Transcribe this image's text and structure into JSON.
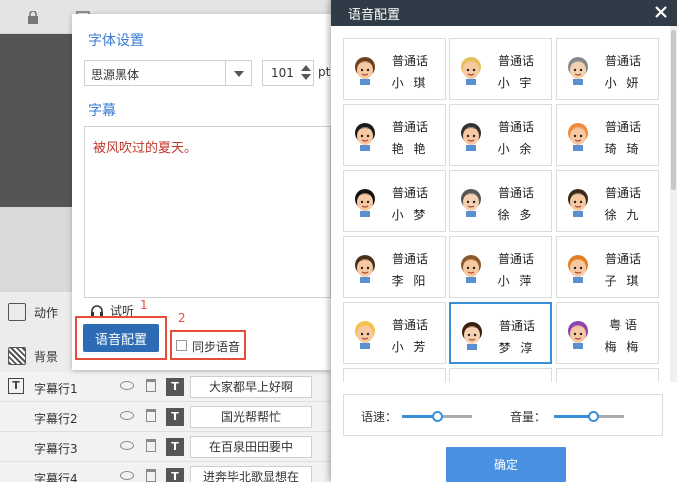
{
  "font_panel": {
    "title": "字体设置",
    "font_name": "思源黑体",
    "font_size": "101",
    "size_unit": "pt",
    "subtitle_title": "字幕",
    "subtitle_text": "被风吹过的夏天。",
    "listen_label": "试听",
    "voice_config_label": "语音配置",
    "sync_label": "同步语音",
    "badge_1": "1",
    "badge_2": "2"
  },
  "left_tools": [
    {
      "label": "动作",
      "icon": "action-icon"
    },
    {
      "label": "背景",
      "icon": "background-icon"
    }
  ],
  "layers": [
    {
      "name": "字幕行1",
      "text": "大家都早上好啊"
    },
    {
      "name": "字幕行2",
      "text": "国光帮帮忙"
    },
    {
      "name": "字幕行3",
      "text": "在百泉田田要中"
    },
    {
      "name": "字幕行4",
      "text": "进奔毕北歌显想在"
    }
  ],
  "voice_dialog": {
    "title": "语音配置",
    "close_icon": "close-icon",
    "voices": [
      {
        "type": "普通话",
        "name": "小 琪",
        "hair": "#6b3e1f",
        "skin": "#f6c9a3"
      },
      {
        "type": "普通话",
        "name": "小 宇",
        "hair": "#e8c15a",
        "skin": "#f6c9a3"
      },
      {
        "type": "普通话",
        "name": "小 妍",
        "hair": "#888888",
        "skin": "#f4d1b0"
      },
      {
        "type": "普通话",
        "name": "艳 艳",
        "hair": "#1a1a1a",
        "skin": "#f6c9a3"
      },
      {
        "type": "普通话",
        "name": "小 余",
        "hair": "#333333",
        "skin": "#f6c9a3"
      },
      {
        "type": "普通话",
        "name": "琦 琦",
        "hair": "#f08a3c",
        "skin": "#f6c9a3"
      },
      {
        "type": "普通话",
        "name": "小 梦",
        "hair": "#111111",
        "skin": "#f6c9a3"
      },
      {
        "type": "普通话",
        "name": "徐 多",
        "hair": "#555555",
        "skin": "#f4d1b0"
      },
      {
        "type": "普通话",
        "name": "徐 九",
        "hair": "#3b2a1a",
        "skin": "#f6c9a3"
      },
      {
        "type": "普通话",
        "name": "李 阳",
        "hair": "#4a3018",
        "skin": "#f6c9a3"
      },
      {
        "type": "普通话",
        "name": "小 萍",
        "hair": "#8b5a2b",
        "skin": "#f6c9a3"
      },
      {
        "type": "普通话",
        "name": "子 琪",
        "hair": "#e67e22",
        "skin": "#f6c9a3"
      },
      {
        "type": "普通话",
        "name": "小 芳",
        "hair": "#f2c14e",
        "skin": "#f6c9a3"
      },
      {
        "type": "普通话",
        "name": "梦 淳",
        "hair": "#3b1f10",
        "skin": "#f4d1b0"
      },
      {
        "type": "粤 语",
        "name": "梅 梅",
        "hair": "#8e44ad",
        "skin": "#f6c9a3"
      }
    ],
    "selected_index": 13,
    "speed_label": "语速：",
    "volume_label": "音量：",
    "speed_level": 0.5,
    "volume_level": 0.55,
    "confirm_label": "确定",
    "accent_color": "#4a90e2"
  }
}
